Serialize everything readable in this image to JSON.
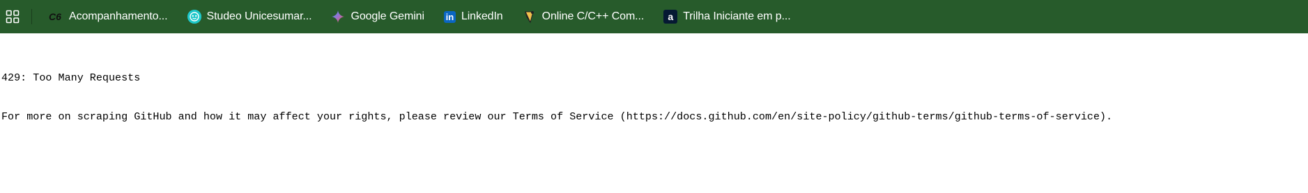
{
  "bookmarks_bar": {
    "apps_icon": "apps-grid-icon",
    "items": [
      {
        "label": "Acompanhamento...",
        "icon": "c6-logo-icon",
        "icon_text": "C6"
      },
      {
        "label": "Studeo Unicesumar...",
        "icon": "studeo-icon"
      },
      {
        "label": "Google Gemini",
        "icon": "gemini-sparkle-icon"
      },
      {
        "label": "LinkedIn",
        "icon": "linkedin-icon",
        "icon_text": "in"
      },
      {
        "label": "Online C/C++ Com...",
        "icon": "gdb-online-icon"
      },
      {
        "label": "Trilha Iniciante em p...",
        "icon": "alura-icon",
        "icon_text": "a"
      }
    ],
    "colors": {
      "background": "#275b2b",
      "text": "#ffffff"
    }
  },
  "page": {
    "error_line": "429: Too Many Requests",
    "message_line": "For more on scraping GitHub and how it may affect your rights, please review our Terms of Service (https://docs.github.com/en/site-policy/github-terms/github-terms-of-service)."
  }
}
